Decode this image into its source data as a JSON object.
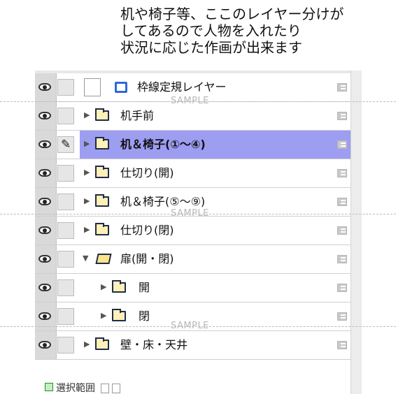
{
  "caption": {
    "line1": "机や椅子等、ここのレイヤー分けが",
    "line2": "してあるので人物を入れたり",
    "line3": "状況に応じた作画が出来ます"
  },
  "layers": [
    {
      "name": "枠線定規レイヤー",
      "type": "frame",
      "selected": false
    },
    {
      "name": "机手前",
      "type": "folder",
      "selected": false
    },
    {
      "name": "机＆椅子(①〜④)",
      "type": "folder",
      "selected": true
    },
    {
      "name": "仕切り(開)",
      "type": "folder",
      "selected": false
    },
    {
      "name": "机＆椅子(⑤〜⑨)",
      "type": "folder",
      "selected": false
    },
    {
      "name": "仕切り(閉)",
      "type": "folder",
      "selected": false
    },
    {
      "name": "扉(開・閉)",
      "type": "folder-open",
      "selected": false
    },
    {
      "name": "開",
      "type": "folder",
      "selected": false,
      "indent": true
    },
    {
      "name": "閉",
      "type": "folder",
      "selected": false,
      "indent": true
    },
    {
      "name": "壁・床・天井",
      "type": "folder",
      "selected": false
    }
  ],
  "watermark": "SAMPLE",
  "bottom_label": "選択範囲",
  "colors": {
    "selected_row": "#9d9df2",
    "frame_icon": "#2f6ad6"
  },
  "icons": {
    "visibility": "eye-icon",
    "edit_target": "pen-icon",
    "mask": "mask-icon"
  }
}
